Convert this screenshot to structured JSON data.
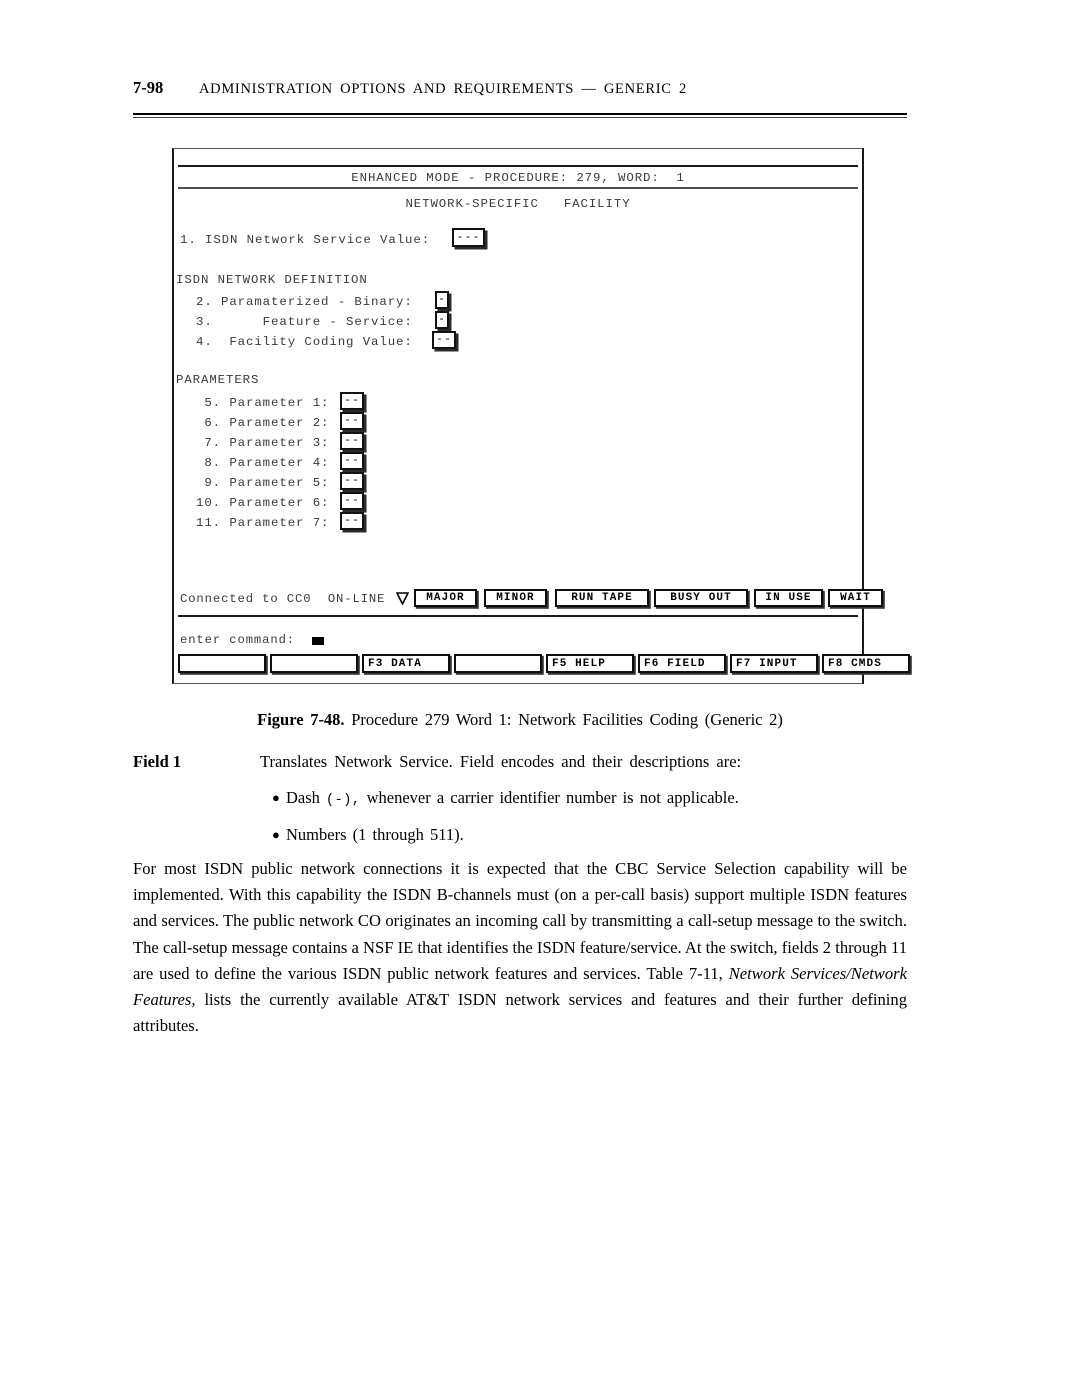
{
  "page": {
    "folio": "7-98",
    "running_title": "ADMINISTRATION OPTIONS AND REQUIREMENTS — GENERIC 2"
  },
  "terminal": {
    "title_line": "ENHANCED MODE - PROCEDURE: 279, WORD:  1",
    "subtitle_line": "NETWORK-SPECIFIC   FACILITY",
    "field1": {
      "label": "1. ISDN Network Service Value:",
      "value": "---"
    },
    "section_isdn_heading": "ISDN NETWORK DEFINITION",
    "isdn_fields": [
      {
        "label": "2. Paramaterized - Binary:",
        "value": "-"
      },
      {
        "label": "3.      Feature - Service:",
        "value": "-"
      },
      {
        "label": "4.  Facility Coding Value:",
        "value": "--"
      }
    ],
    "section_parameters_heading": "PARAMETERS",
    "parameters": [
      {
        "label": " 5. Parameter 1:",
        "value": "--"
      },
      {
        "label": " 6. Parameter 2:",
        "value": "--"
      },
      {
        "label": " 7. Parameter 3:",
        "value": "--"
      },
      {
        "label": " 8. Parameter 4:",
        "value": "--"
      },
      {
        "label": " 9. Parameter 5:",
        "value": "--"
      },
      {
        "label": "10. Parameter 6:",
        "value": "--"
      },
      {
        "label": "11. Parameter 7:",
        "value": "--"
      }
    ],
    "status": {
      "connected_text": "Connected to CC0  ON-LINE",
      "marker_icon": "triangle-down-icon",
      "indicators": [
        {
          "label": "MAJOR"
        },
        {
          "label": "MINOR"
        },
        {
          "label": "RUN TAPE"
        },
        {
          "label": "BUSY OUT"
        },
        {
          "label": "IN USE"
        },
        {
          "label": "WAIT"
        }
      ]
    },
    "command": {
      "label": "enter command:",
      "value": ""
    },
    "function_keys": [
      {
        "label": ""
      },
      {
        "label": ""
      },
      {
        "label": "F3 DATA"
      },
      {
        "label": ""
      },
      {
        "label": "F5 HELP"
      },
      {
        "label": "F6 FIELD"
      },
      {
        "label": "F7 INPUT"
      },
      {
        "label": "F8 CMDS"
      }
    ]
  },
  "caption": {
    "number": "Figure 7-48.",
    "text": "Procedure 279 Word 1: Network Facilities Coding (Generic 2)"
  },
  "field_section": {
    "label": "Field 1",
    "description": "Translates Network Service. Field encodes and their descriptions are:",
    "bullets": [
      {
        "lead": "Dash",
        "mono": "(-),",
        "rest": "whenever a carrier identifier number is not applicable."
      },
      {
        "lead": "Numbers (1 through 511).",
        "mono": "",
        "rest": ""
      }
    ]
  },
  "body": {
    "part1": "For most ISDN public network connections it is expected that the CBC Service Selection capability will be implemented. With this capability the ISDN B-channels must (on a per-call basis) support multiple ISDN features and services. The public network CO originates an incoming call by transmitting a call-setup message to the switch. The call-setup message contains a NSF IE that identifies the ISDN feature/service. At the switch, fields 2 through 11 are used to define the various ISDN public network features and services. Table 7-11, ",
    "italic": "Network Services/Network Features,",
    "part2": " lists the currently available AT&T ISDN network services and features and their further defining attributes."
  }
}
